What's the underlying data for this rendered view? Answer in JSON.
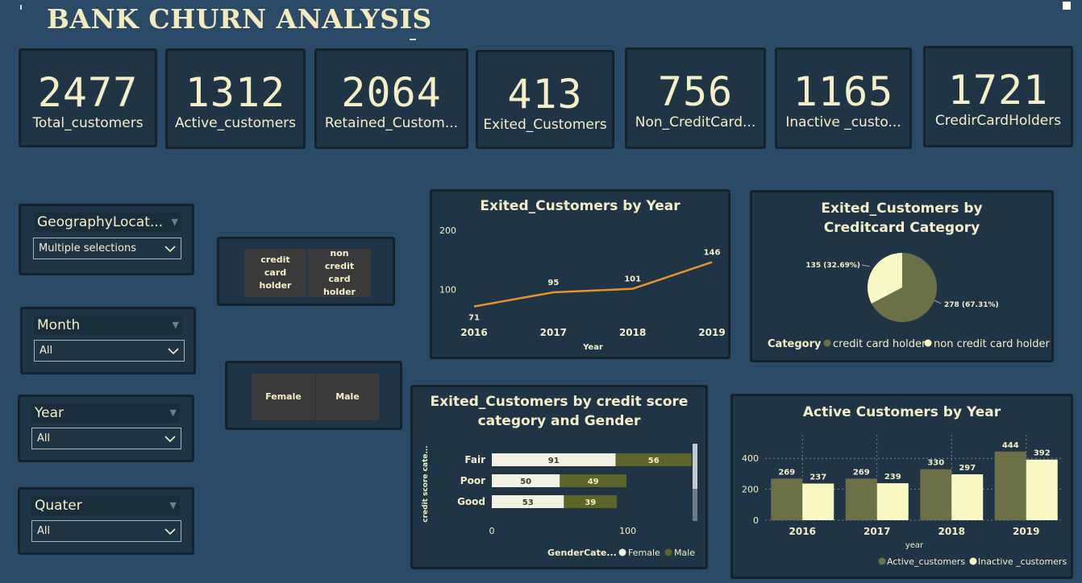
{
  "header": {
    "title": "BANK CHURN ANALYSIS"
  },
  "kpis": [
    {
      "value": "2477",
      "label": "Total_customers"
    },
    {
      "value": "1312",
      "label": "Active_customers"
    },
    {
      "value": "2064",
      "label": "Retained_Custom..."
    },
    {
      "value": "413",
      "label": "Exited_Customers"
    },
    {
      "value": "756",
      "label": "Non_CreditCard..."
    },
    {
      "value": "1165",
      "label": "Inactive _custo..."
    },
    {
      "value": "1721",
      "label": "CredirCardHolders"
    }
  ],
  "slicers": {
    "geography": {
      "title": "GeographyLocat...",
      "value": "Multiple selections"
    },
    "month": {
      "title": "Month",
      "value": "All"
    },
    "year": {
      "title": "Year",
      "value": "All"
    },
    "quarter": {
      "title": "Quater",
      "value": "All"
    }
  },
  "tiles": {
    "credit": [
      "credit card holder",
      "non credit card holder"
    ],
    "gender": [
      "Female",
      "Male"
    ]
  },
  "colors": {
    "accent_line": "#e8912d",
    "olive": "#6b7047",
    "cream": "#faf9c6",
    "female": "#f1f2e2",
    "male": "#5c6428"
  },
  "chart_data": [
    {
      "type": "line",
      "title": "Exited_Customers by Year",
      "xlabel": "Year",
      "x": [
        "2016",
        "2017",
        "2018",
        "2019"
      ],
      "values": [
        71,
        95,
        101,
        146
      ],
      "value_labels": [
        "71",
        "95",
        "101",
        "146"
      ],
      "yticks": [
        "200",
        "100"
      ],
      "ylim": [
        50,
        200
      ]
    },
    {
      "type": "pie",
      "title": "Exited_Customers by Creditcard Category",
      "legend_title": "Category",
      "slices": [
        {
          "name": "credit card holder",
          "value": 278,
          "label": "278 (67.31%)",
          "color": "#6b7047"
        },
        {
          "name": "non credit card holder",
          "value": 135,
          "label": "135 (32.69%)",
          "color": "#faf9c6"
        }
      ]
    },
    {
      "type": "bar",
      "orientation": "horizontal-stacked",
      "title": "Exited_Customers by credit score category and Gender",
      "ylabel": "credit score cate...",
      "legend_title": "GenderCate...",
      "categories": [
        "Fair",
        "Poor",
        "Good"
      ],
      "series": [
        {
          "name": "Female",
          "values": [
            91,
            50,
            53
          ]
        },
        {
          "name": "Male",
          "values": [
            56,
            49,
            39
          ]
        }
      ],
      "xticks": [
        "0",
        "100"
      ],
      "xlim": [
        0,
        150
      ]
    },
    {
      "type": "bar",
      "title": "Active Customers by Year",
      "xlabel": "year",
      "categories": [
        "2016",
        "2017",
        "2018",
        "2019"
      ],
      "series": [
        {
          "name": "Active_customers",
          "values": [
            269,
            269,
            330,
            444
          ]
        },
        {
          "name": "Inactive _customers",
          "values": [
            237,
            239,
            297,
            392
          ]
        }
      ],
      "yticks": [
        "400",
        "200",
        "0"
      ],
      "ylim": [
        0,
        500
      ]
    }
  ]
}
